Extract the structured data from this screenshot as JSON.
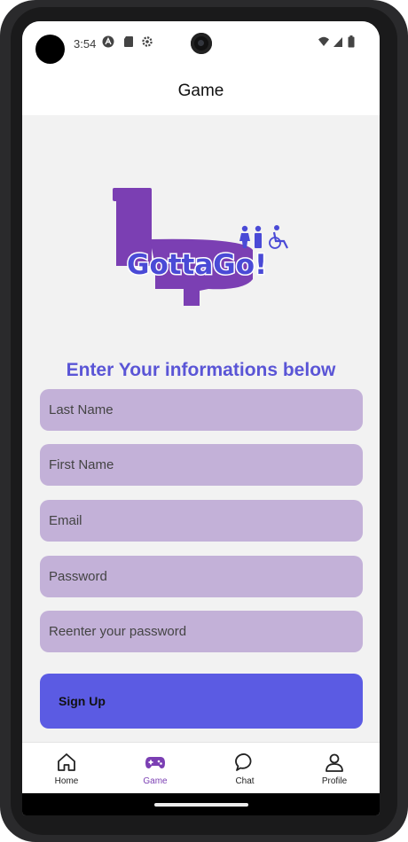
{
  "status_bar": {
    "time": "3:54",
    "icons": [
      "a-icon",
      "sim-card-icon",
      "settings-icon",
      "wifi-icon",
      "signal-icon",
      "battery-icon"
    ]
  },
  "app_bar": {
    "title": "Game"
  },
  "logo": {
    "text": "GottaGo!"
  },
  "form": {
    "heading": "Enter Your informations below",
    "last_name": {
      "placeholder": "Last Name",
      "value": ""
    },
    "first_name": {
      "placeholder": "First Name",
      "value": ""
    },
    "email": {
      "placeholder": "Email",
      "value": ""
    },
    "password": {
      "placeholder": "Password",
      "value": ""
    },
    "reenter_password": {
      "placeholder": "Reenter your password",
      "value": ""
    },
    "signup_label": "Sign Up"
  },
  "bottom_nav": {
    "items": [
      {
        "label": "Home",
        "icon": "home-icon"
      },
      {
        "label": "Game",
        "icon": "gamepad-icon",
        "active": true
      },
      {
        "label": "Chat",
        "icon": "chat-icon"
      },
      {
        "label": "Profile",
        "icon": "profile-icon"
      }
    ]
  },
  "colors": {
    "accent": "#5b5be3",
    "heading": "#5a55d6",
    "field_bg": "#c3b1d8",
    "active_nav": "#7b3fb3",
    "logo_purple": "#7b3fb3",
    "logo_text": "#4a4ad6"
  }
}
